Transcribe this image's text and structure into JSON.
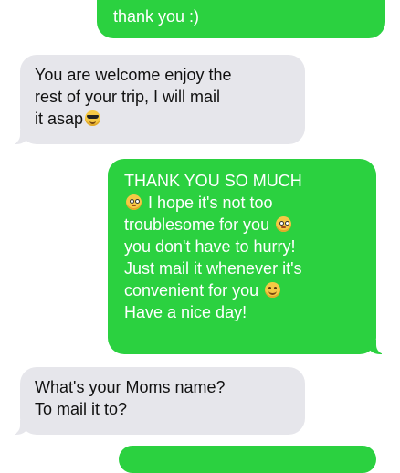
{
  "messages": [
    {
      "sender": "me",
      "lines": [
        "thank you :)"
      ]
    },
    {
      "sender": "them",
      "lines": [
        "You are welcome enjoy the",
        "rest of your trip, I will mail",
        "it asap"
      ],
      "emoji": "smiling-face-with-sunglasses"
    },
    {
      "sender": "me",
      "lines": [
        "THANK YOU SO MUCH",
        "I hope it's not too",
        "troublesome for you",
        "you don't have to hurry!",
        "Just mail it whenever it's",
        "convenient for you",
        "Have a nice day!"
      ],
      "emojis": [
        "flushed-face",
        "flushed-face",
        "smiling-face"
      ]
    },
    {
      "sender": "them",
      "lines": [
        "What's your Moms name?",
        "To mail it to?"
      ]
    },
    {
      "sender": "me",
      "lines": []
    }
  ],
  "colors": {
    "sent_bubble": "#2bd140",
    "received_bubble": "#e6e6eb",
    "sent_text": "#ffffff",
    "received_text": "#111111"
  }
}
